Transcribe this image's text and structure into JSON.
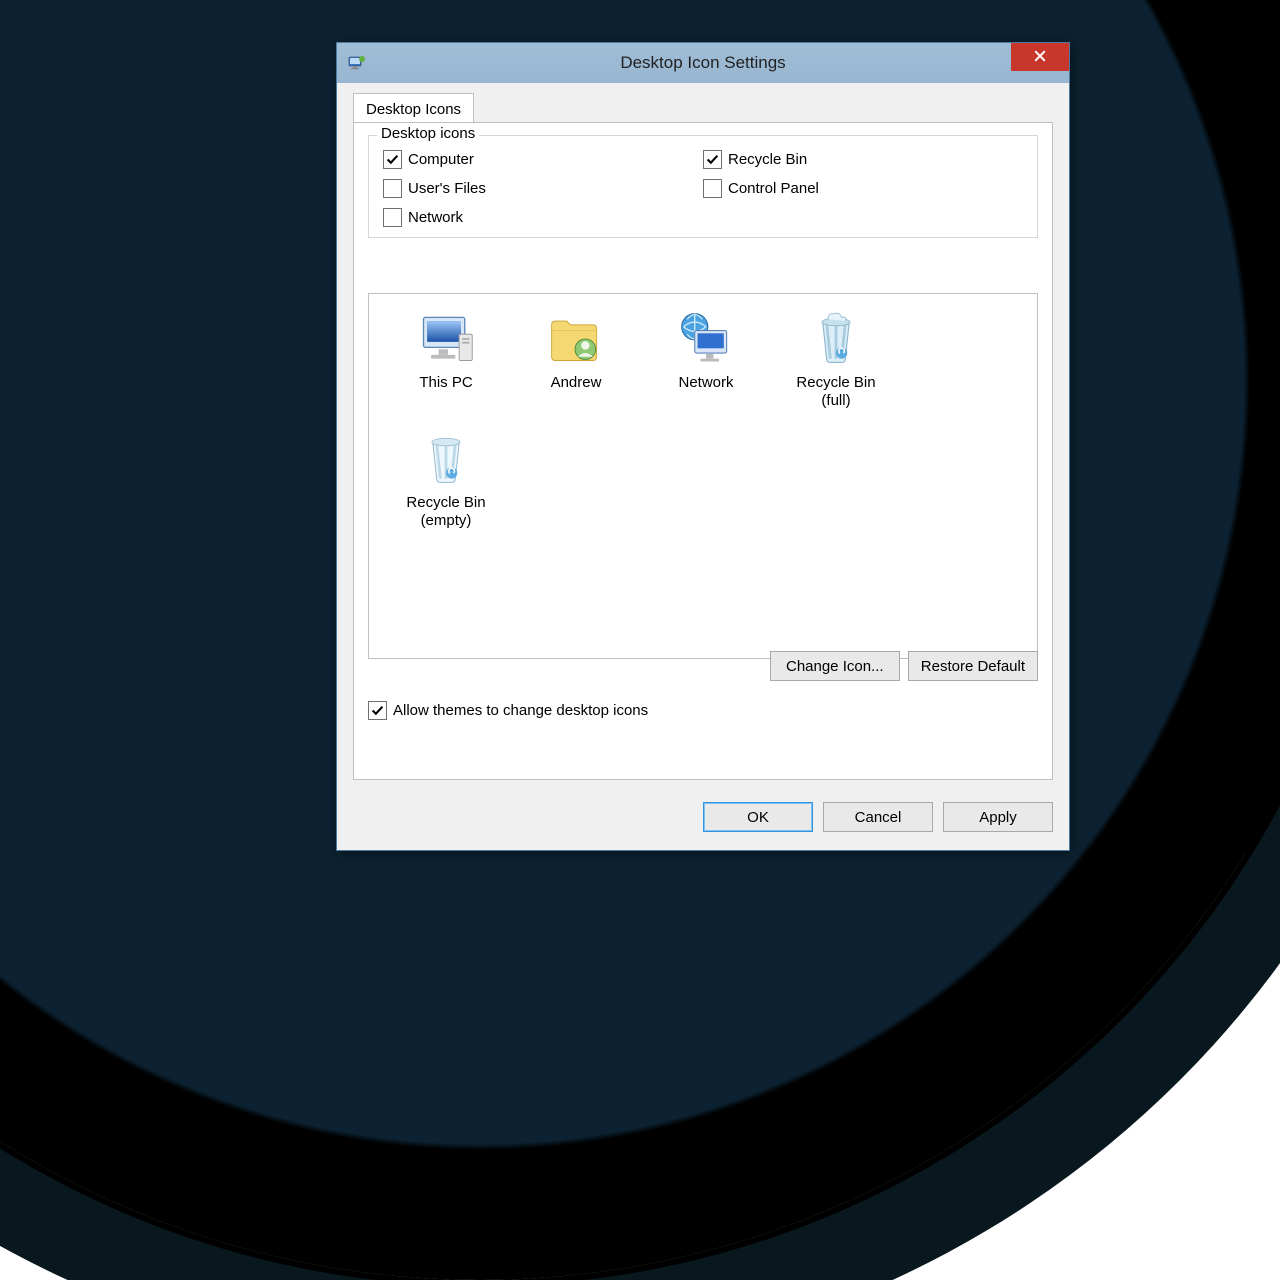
{
  "window": {
    "title": "Desktop Icon Settings",
    "tab_label": "Desktop Icons"
  },
  "group": {
    "legend": "Desktop icons",
    "checks": [
      {
        "id": "computer",
        "label": "Computer",
        "checked": true
      },
      {
        "id": "recyclebin",
        "label": "Recycle Bin",
        "checked": true
      },
      {
        "id": "userfiles",
        "label": "User's Files",
        "checked": false
      },
      {
        "id": "controlpanel",
        "label": "Control Panel",
        "checked": false
      },
      {
        "id": "network",
        "label": "Network",
        "checked": false
      }
    ]
  },
  "icons": [
    {
      "id": "thispc",
      "label": "This PC"
    },
    {
      "id": "andrew",
      "label": "Andrew"
    },
    {
      "id": "network",
      "label": "Network"
    },
    {
      "id": "recyclefull",
      "label": "Recycle Bin\n(full)"
    },
    {
      "id": "recycleempty",
      "label": "Recycle Bin\n(empty)"
    }
  ],
  "buttons": {
    "change_icon": "Change Icon...",
    "restore_default": "Restore Default",
    "ok": "OK",
    "cancel": "Cancel",
    "apply": "Apply"
  },
  "allow_themes": {
    "label": "Allow themes to change desktop icons",
    "checked": true
  }
}
